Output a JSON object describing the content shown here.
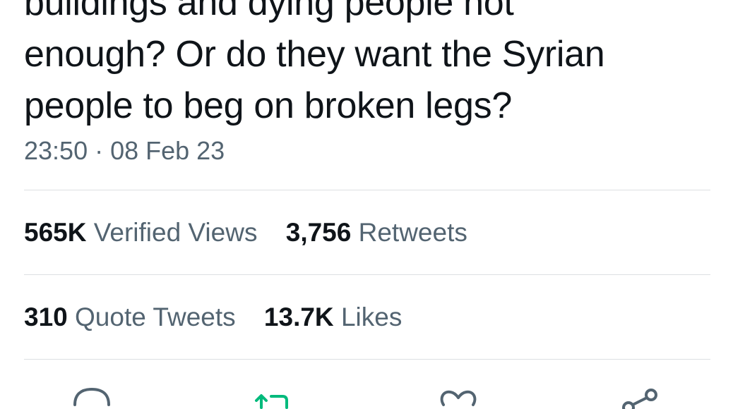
{
  "tweet": {
    "text_lines": [
      "buildings and dying people not",
      "enough? Or do they want the Syrian",
      "people to beg on broken legs?"
    ],
    "timestamp": "23:50 · 08 Feb 23"
  },
  "stats": {
    "views_count": "565K",
    "views_label": "Verified Views",
    "retweets_count": "3,756",
    "retweets_label": "Retweets",
    "quotes_count": "310",
    "quotes_label": "Quote Tweets",
    "likes_count": "13.7K",
    "likes_label": "Likes"
  },
  "actions": {
    "icons": [
      "reply-icon",
      "retweet-icon",
      "like-icon",
      "share-icon"
    ],
    "retweet_active_color": "#00ba7c",
    "icon_color": "#536471"
  }
}
